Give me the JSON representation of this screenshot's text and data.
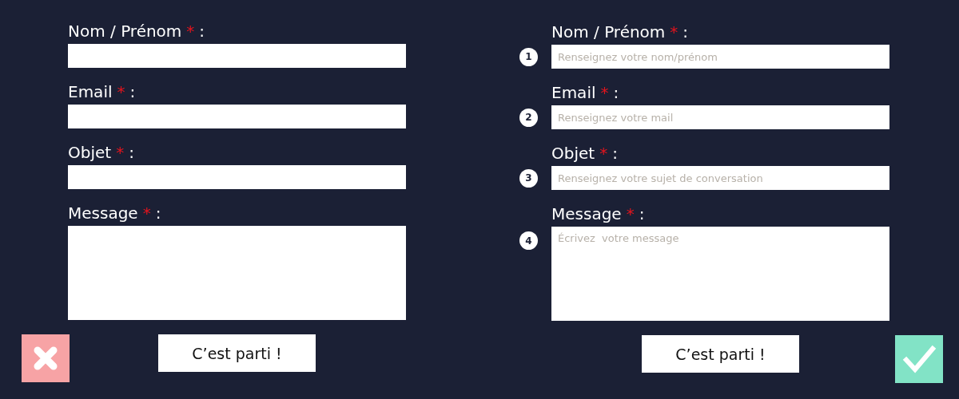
{
  "forms": [
    {
      "verdict": {
        "kind": "wrong"
      },
      "submit": "C’est parti !",
      "fields": [
        {
          "kind": "line",
          "label": "Nom / Prénom",
          "required_mark": "*",
          "suffix": ":"
        },
        {
          "kind": "line",
          "label": "Email",
          "required_mark": "*",
          "suffix": ":"
        },
        {
          "kind": "line",
          "label": "Objet",
          "required_mark": "*",
          "suffix": ":"
        },
        {
          "kind": "area",
          "label": "Message",
          "required_mark": "*",
          "suffix": ":"
        }
      ]
    },
    {
      "verdict": {
        "kind": "right"
      },
      "submit": "C’est parti !",
      "fields": [
        {
          "kind": "line",
          "number": "1",
          "label": "Nom / Prénom",
          "required_mark": "*",
          "suffix": ":",
          "placeholder": "Renseignez votre nom/prénom"
        },
        {
          "kind": "line",
          "number": "2",
          "label": "Email",
          "required_mark": "*",
          "suffix": ":",
          "placeholder": "Renseignez votre mail"
        },
        {
          "kind": "line",
          "number": "3",
          "label": "Objet",
          "required_mark": "*",
          "suffix": ":",
          "placeholder": "Renseignez votre sujet de conversation"
        },
        {
          "kind": "area",
          "number": "4",
          "label": "Message",
          "required_mark": "*",
          "suffix": ":",
          "placeholder": "Écrivez  votre message"
        }
      ]
    }
  ]
}
